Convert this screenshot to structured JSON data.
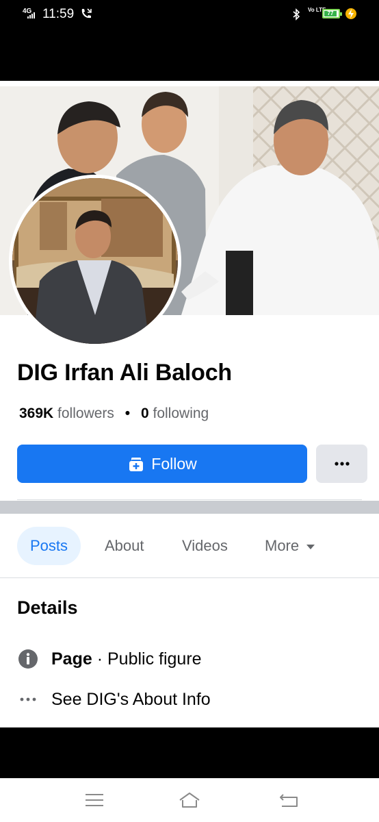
{
  "status_bar": {
    "network": "4G",
    "time": "11:59",
    "volte": "Vo LTE",
    "battery": "77"
  },
  "profile": {
    "name": "DIG Irfan Ali Baloch",
    "followers_count": "369K",
    "followers_label": "followers",
    "separator": "•",
    "following_count": "0",
    "following_label": "following"
  },
  "actions": {
    "follow_label": "Follow",
    "more_label": "•••"
  },
  "tabs": [
    {
      "label": "Posts",
      "active": true
    },
    {
      "label": "About",
      "active": false
    },
    {
      "label": "Videos",
      "active": false
    },
    {
      "label": "More",
      "active": false
    }
  ],
  "details": {
    "title": "Details",
    "page_label": "Page",
    "page_sep": " · ",
    "page_category": "Public figure",
    "about_link": "See DIG's About Info"
  },
  "icons": {
    "info": "info-circle-icon",
    "more": "ellipsis-icon",
    "follow": "follow-icon",
    "nav_menu": "menu-icon",
    "nav_home": "home-icon",
    "nav_back": "back-icon"
  },
  "colors": {
    "brand_blue": "#1877f2",
    "tab_active_bg": "#e7f3ff",
    "secondary_text": "#65676b",
    "button_gray": "#e4e6eb"
  }
}
